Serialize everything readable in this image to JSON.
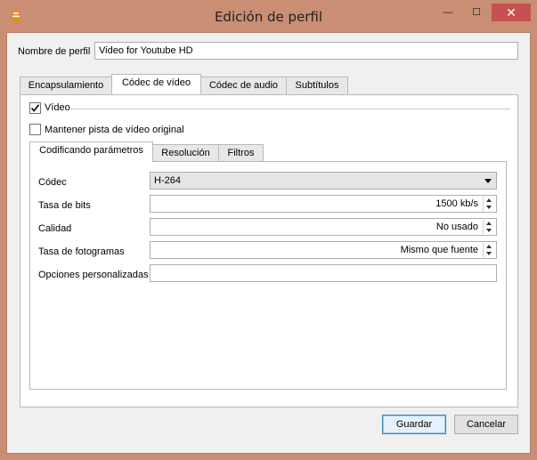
{
  "window": {
    "title": "Edición de perfil",
    "minimize_glyph": "—",
    "maximize_glyph": "☐",
    "close_glyph": "✕"
  },
  "profile": {
    "label": "Nombre de perfil",
    "value": "Video for Youtube HD"
  },
  "main_tabs": [
    {
      "label": "Encapsulamiento"
    },
    {
      "label": "Códec de vídeo"
    },
    {
      "label": "Códec de audio"
    },
    {
      "label": "Subtítulos"
    }
  ],
  "video_checkbox": {
    "label": "Vídeo",
    "checked": true
  },
  "keep_original": {
    "label": "Mantener pista de vídeo original",
    "checked": false
  },
  "sub_tabs": [
    {
      "label": "Codificando parámetros"
    },
    {
      "label": "Resolución"
    },
    {
      "label": "Filtros"
    }
  ],
  "fields": {
    "codec": {
      "label": "Códec",
      "value": "H-264"
    },
    "bitrate": {
      "label": "Tasa de bits",
      "value": "1500 kb/s"
    },
    "quality": {
      "label": "Calidad",
      "value": "No usado"
    },
    "framerate": {
      "label": "Tasa de fotogramas",
      "value": "Mismo que fuente"
    },
    "custom": {
      "label": "Opciones personalizadas",
      "value": ""
    }
  },
  "buttons": {
    "save": "Guardar",
    "cancel": "Cancelar"
  },
  "colors": {
    "frame": "#c98e74",
    "close_button": "#c75050",
    "accent": "#3c7fb1"
  }
}
